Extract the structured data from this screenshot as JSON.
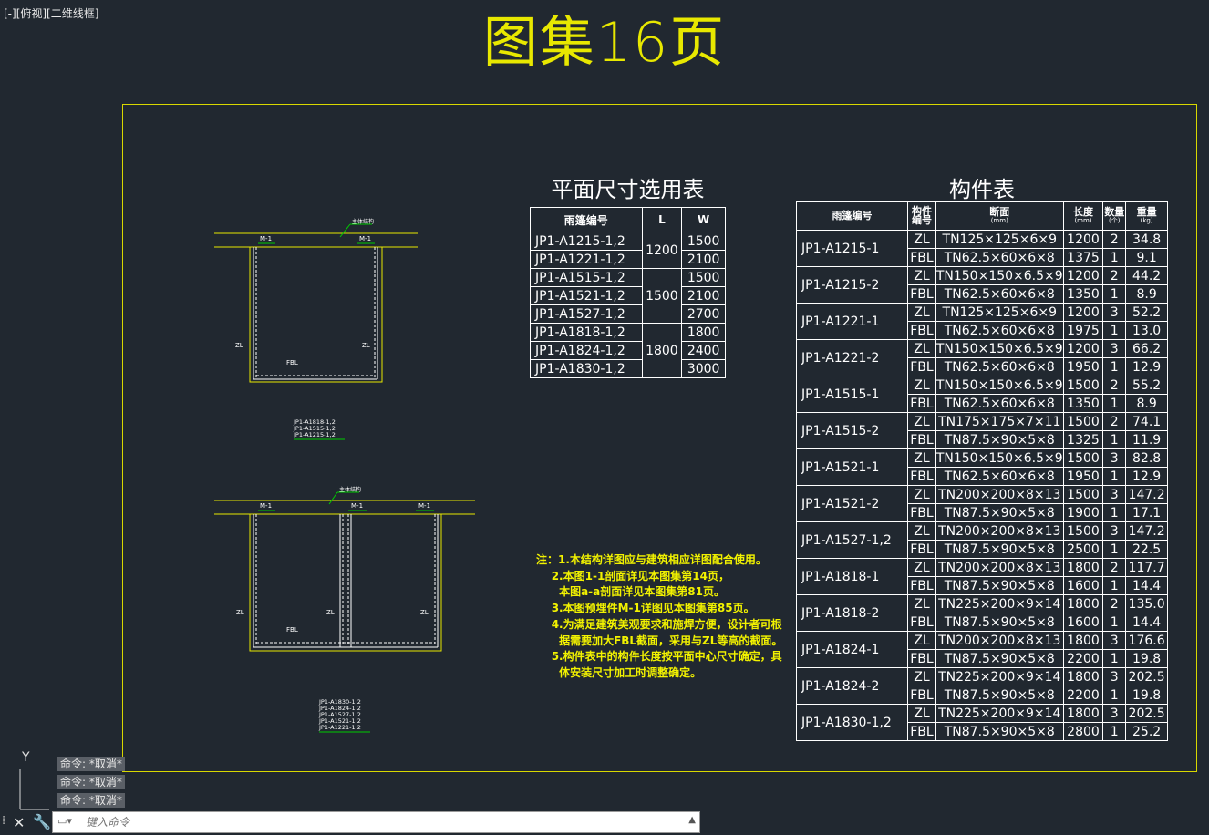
{
  "viewport_label": "[-][俯视][二维线框]",
  "drawing_title": "图集16页",
  "plan_table": {
    "title": "平面尺寸选用表",
    "headers": [
      "雨篷编号",
      "L",
      "W"
    ],
    "rows": [
      {
        "code": "JP1-A1215-1,2",
        "L": "1200",
        "W": "1500"
      },
      {
        "code": "JP1-A1221-1,2",
        "L": "",
        "W": "2100"
      },
      {
        "code": "JP1-A1515-1,2",
        "L": "",
        "W": "1500"
      },
      {
        "code": "JP1-A1521-1,2",
        "L": "1500",
        "W": "2100"
      },
      {
        "code": "JP1-A1527-1,2",
        "L": "",
        "W": "2700"
      },
      {
        "code": "JP1-A1818-1,2",
        "L": "",
        "W": "1800"
      },
      {
        "code": "JP1-A1824-1,2",
        "L": "1800",
        "W": "2400"
      },
      {
        "code": "JP1-A1830-1,2",
        "L": "",
        "W": "3000"
      }
    ],
    "L_groups": [
      {
        "value": "1200",
        "span": 2
      },
      {
        "value": "1500",
        "span": 3
      },
      {
        "value": "1800",
        "span": 3
      }
    ]
  },
  "member_table": {
    "title": "构件表",
    "headers": {
      "code": "雨篷编号",
      "part": "构件编号",
      "section": "断面",
      "section_unit": "(mm)",
      "length": "长度",
      "length_unit": "(mm)",
      "qty": "数量",
      "qty_unit": "(个)",
      "weight": "重量",
      "weight_unit": "(kg)"
    },
    "groups": [
      {
        "code": "JP1-A1215-1",
        "rows": [
          [
            "ZL",
            "TN125×125×6×9",
            "1200",
            "2",
            "34.8"
          ],
          [
            "FBL",
            "TN62.5×60×6×8",
            "1375",
            "1",
            "9.1"
          ]
        ]
      },
      {
        "code": "JP1-A1215-2",
        "rows": [
          [
            "ZL",
            "TN150×150×6.5×9",
            "1200",
            "2",
            "44.2"
          ],
          [
            "FBL",
            "TN62.5×60×6×8",
            "1350",
            "1",
            "8.9"
          ]
        ]
      },
      {
        "code": "JP1-A1221-1",
        "rows": [
          [
            "ZL",
            "TN125×125×6×9",
            "1200",
            "3",
            "52.2"
          ],
          [
            "FBL",
            "TN62.5×60×6×8",
            "1975",
            "1",
            "13.0"
          ]
        ]
      },
      {
        "code": "JP1-A1221-2",
        "rows": [
          [
            "ZL",
            "TN150×150×6.5×9",
            "1200",
            "3",
            "66.2"
          ],
          [
            "FBL",
            "TN62.5×60×6×8",
            "1950",
            "1",
            "12.9"
          ]
        ]
      },
      {
        "code": "JP1-A1515-1",
        "rows": [
          [
            "ZL",
            "TN150×150×6.5×9",
            "1500",
            "2",
            "55.2"
          ],
          [
            "FBL",
            "TN62.5×60×6×8",
            "1350",
            "1",
            "8.9"
          ]
        ]
      },
      {
        "code": "JP1-A1515-2",
        "rows": [
          [
            "ZL",
            "TN175×175×7×11",
            "1500",
            "2",
            "74.1"
          ],
          [
            "FBL",
            "TN87.5×90×5×8",
            "1325",
            "1",
            "11.9"
          ]
        ]
      },
      {
        "code": "JP1-A1521-1",
        "rows": [
          [
            "ZL",
            "TN150×150×6.5×9",
            "1500",
            "3",
            "82.8"
          ],
          [
            "FBL",
            "TN62.5×60×6×8",
            "1950",
            "1",
            "12.9"
          ]
        ]
      },
      {
        "code": "JP1-A1521-2",
        "rows": [
          [
            "ZL",
            "TN200×200×8×13",
            "1500",
            "3",
            "147.2"
          ],
          [
            "FBL",
            "TN87.5×90×5×8",
            "1900",
            "1",
            "17.1"
          ]
        ]
      },
      {
        "code": "JP1-A1527-1,2",
        "rows": [
          [
            "ZL",
            "TN200×200×8×13",
            "1500",
            "3",
            "147.2"
          ],
          [
            "FBL",
            "TN87.5×90×5×8",
            "2500",
            "1",
            "22.5"
          ]
        ]
      },
      {
        "code": "JP1-A1818-1",
        "rows": [
          [
            "ZL",
            "TN200×200×8×13",
            "1800",
            "2",
            "117.7"
          ],
          [
            "FBL",
            "TN87.5×90×5×8",
            "1600",
            "1",
            "14.4"
          ]
        ]
      },
      {
        "code": "JP1-A1818-2",
        "rows": [
          [
            "ZL",
            "TN225×200×9×14",
            "1800",
            "2",
            "135.0"
          ],
          [
            "FBL",
            "TN87.5×90×5×8",
            "1600",
            "1",
            "14.4"
          ]
        ]
      },
      {
        "code": "JP1-A1824-1",
        "rows": [
          [
            "ZL",
            "TN200×200×8×13",
            "1800",
            "3",
            "176.6"
          ],
          [
            "FBL",
            "TN87.5×90×5×8",
            "2200",
            "1",
            "19.8"
          ]
        ]
      },
      {
        "code": "JP1-A1824-2",
        "rows": [
          [
            "ZL",
            "TN225×200×9×14",
            "1800",
            "3",
            "202.5"
          ],
          [
            "FBL",
            "TN87.5×90×5×8",
            "2200",
            "1",
            "19.8"
          ]
        ]
      },
      {
        "code": "JP1-A1830-1,2",
        "rows": [
          [
            "ZL",
            "TN225×200×9×14",
            "1800",
            "3",
            "202.5"
          ],
          [
            "FBL",
            "TN87.5×90×5×8",
            "2800",
            "1",
            "25.2"
          ]
        ]
      }
    ]
  },
  "notes": "注：1.本结构详图应与建筑相应详图配合使用。\n    2.本图1-1剖面详见本图集第14页，\n      本图a-a剖面详见本图集第81页。\n    3.本图预埋件M-1详图见本图集第85页。\n    4.为满足建筑美观要求和施焊方便，设计者可根\n      据需要加大FBL截面，采用与ZL等高的截面。\n    5.构件表中的构件长度按平面中心尺寸确定，具\n      体安装尺寸加工时调整确定。",
  "detail1": {
    "embed_label": "主体结构",
    "m1": "M-1",
    "zl": "ZL",
    "fbl": "FBL",
    "codes": [
      "JP1-A1818-1,2",
      "JP1-A1515-1,2",
      "JP1-A1215-1,2"
    ]
  },
  "detail2": {
    "embed_label": "主体结构",
    "m1": "M-1",
    "zl": "ZL",
    "fbl": "FBL",
    "codes": [
      "JP1-A1830-1,2",
      "JP1-A1824-1,2",
      "JP1-A1527-1,2",
      "JP1-A1521-1,2",
      "JP1-A1221-1,2"
    ]
  },
  "ucs": {
    "y_label": "Y"
  },
  "command_history": [
    "命令: *取消*",
    "命令: *取消*",
    "命令: *取消*"
  ],
  "command_placeholder": "键入命令",
  "colors": {
    "background": "#212830",
    "yellow": "#e8e800",
    "green": "#00cc00",
    "white": "#ffffff"
  }
}
